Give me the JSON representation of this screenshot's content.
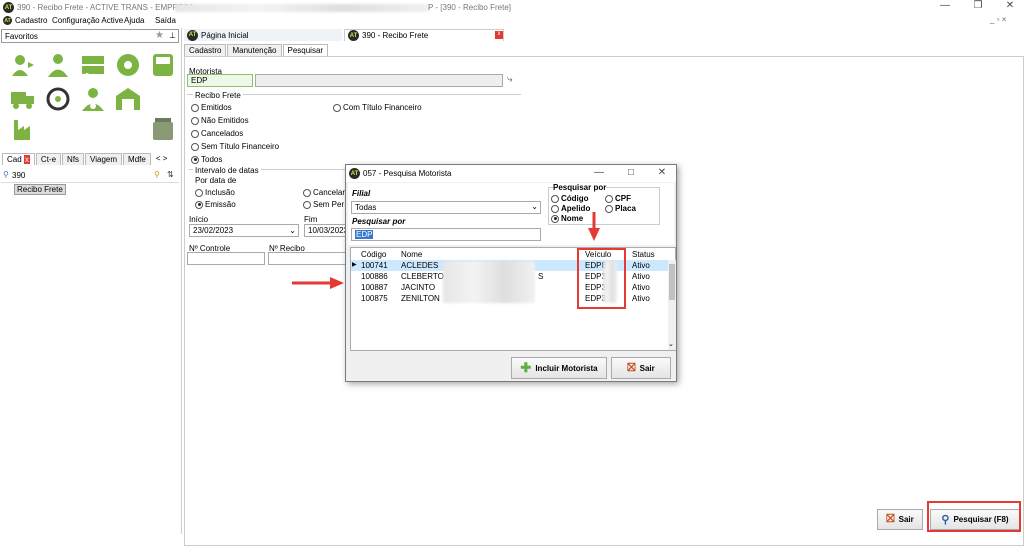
{
  "window": {
    "title_prefix": "390 - Recibo Frete - ACTIVE TRANS - EMPRESA:",
    "title_suffix": "P - [390 - Recibo Frete]"
  },
  "menu": [
    "Cadastro",
    "Configuração Active",
    "Ajuda",
    "Saída"
  ],
  "left": {
    "favorites_label": "Favoritos",
    "tabs": [
      "Cad",
      "Ct-e",
      "Nfs",
      "Viagem",
      "Mdfe"
    ],
    "search_value": "390",
    "result_item": "Recibo Frete"
  },
  "doc_tabs": [
    "Página Inicial",
    "390 - Recibo Frete"
  ],
  "form_tabs": [
    "Cadastro",
    "Manutenção",
    "Pesquisar"
  ],
  "form": {
    "motorista_label": "Motorista",
    "motorista_value": "EDP",
    "recibo_group": "Recibo Frete",
    "recibo_options": [
      "Emitidos",
      "Não Emitidos",
      "Cancelados",
      "Sem Título Financeiro",
      "Todos"
    ],
    "titulo_option": "Com Título Financeiro",
    "intervalo_group": "Intervalo de datas",
    "por_data_label": "Por data de",
    "data_options": [
      "Inclusão",
      "Emissão"
    ],
    "data_options_right": [
      "Cancelar",
      "Sem Per"
    ],
    "inicio_label": "Início",
    "inicio_value": "23/02/2023",
    "fim_label": "Fim",
    "fim_value": "10/03/2023",
    "controle_label": "Nº Controle",
    "recibo_label": "Nº Recibo"
  },
  "buttons": {
    "sair": "Sair",
    "pesquisar": "Pesquisar (F8)"
  },
  "dialog": {
    "title": "057 - Pesquisa Motorista",
    "filial_label": "Filial",
    "filial_value": "Todas",
    "pesquisar_por_label": "Pesquisar por",
    "search_value": "EDP",
    "options_left": [
      "Código",
      "Apelido",
      "Nome"
    ],
    "options_right": [
      "CPF",
      "Placa"
    ],
    "selected_option": "Nome",
    "columns": [
      "Código",
      "Nome",
      "Veículo",
      "Status"
    ],
    "rows": [
      {
        "codigo": "100741",
        "nome": "ACLEDES",
        "veiculo": "EDP8",
        "status": "Ativo"
      },
      {
        "codigo": "100886",
        "nome": "CLEBERTO",
        "veiculo": "EDP3",
        "status": "Ativo"
      },
      {
        "codigo": "100887",
        "nome": "JACINTO",
        "veiculo": "EDP3",
        "status": "Ativo"
      },
      {
        "codigo": "100875",
        "nome": "ZENILTON",
        "veiculo": "EDP3",
        "status": "Ativo"
      }
    ],
    "row2_suffix": "S",
    "incluir_button": "Incluir Motorista",
    "sair_button": "Sair"
  },
  "colors": {
    "accent": "#c6e84a",
    "highlight": "#cce8ff",
    "annotation": "#e53935",
    "icon_green": "#7cb342"
  }
}
